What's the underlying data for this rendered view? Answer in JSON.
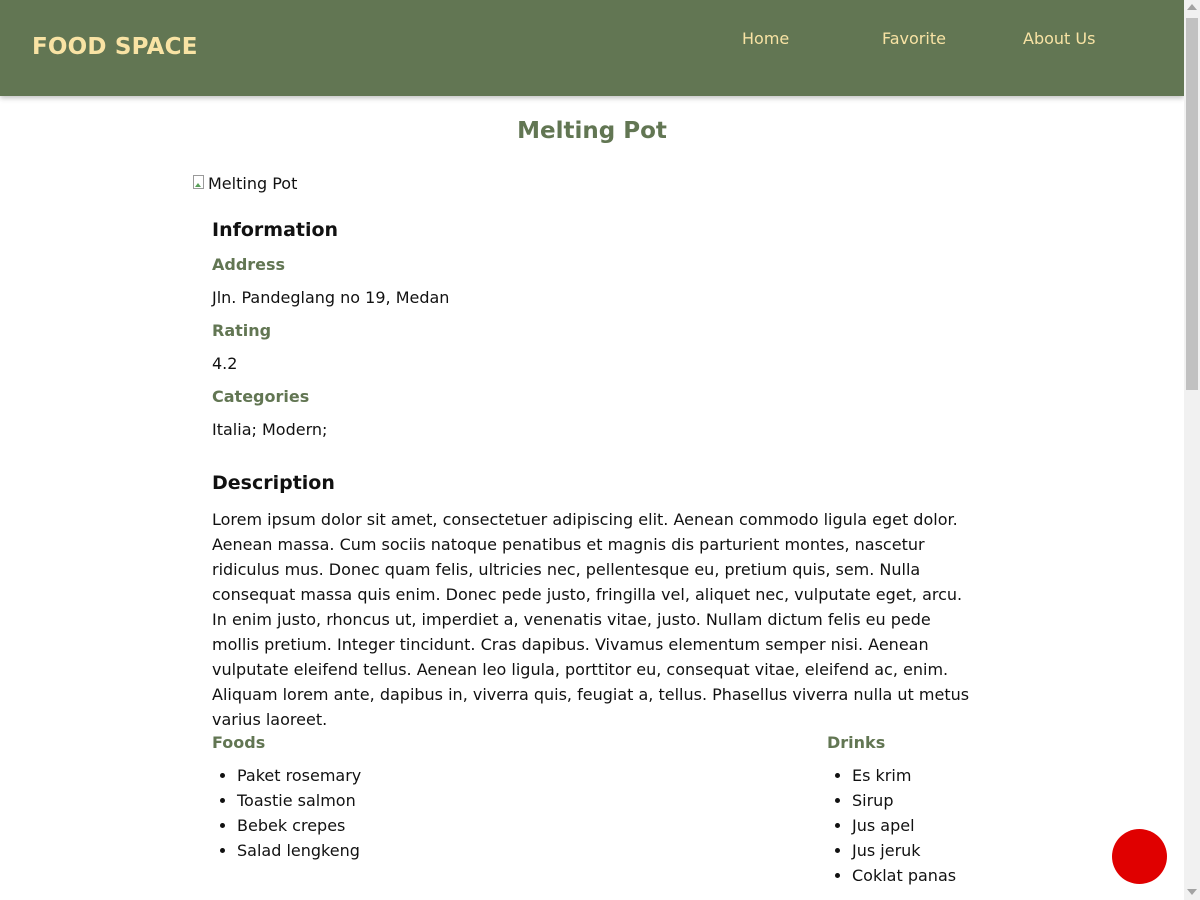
{
  "header": {
    "brand": "FOOD SPACE",
    "nav": {
      "home": "Home",
      "favorite": "Favorite",
      "about": "About Us"
    }
  },
  "restaurant": {
    "name": "Melting Pot",
    "image_alt": "Melting Pot",
    "information_heading": "Information",
    "address_label": "Address",
    "address": "Jln. Pandeglang no 19, Medan",
    "rating_label": "Rating",
    "rating": "4.2",
    "categories_label": "Categories",
    "categories": "Italia; Modern;",
    "description_heading": "Description",
    "description": "Lorem ipsum dolor sit amet, consectetuer adipiscing elit. Aenean commodo ligula eget dolor. Aenean massa. Cum sociis natoque penatibus et magnis dis parturient montes, nascetur ridiculus mus. Donec quam felis, ultricies nec, pellentesque eu, pretium quis, sem. Nulla consequat massa quis enim. Donec pede justo, fringilla vel, aliquet nec, vulputate eget, arcu. In enim justo, rhoncus ut, imperdiet a, venenatis vitae, justo. Nullam dictum felis eu pede mollis pretium. Integer tincidunt. Cras dapibus. Vivamus elementum semper nisi. Aenean vulputate eleifend tellus. Aenean leo ligula, porttitor eu, consequat vitae, eleifend ac, enim. Aliquam lorem ante, dapibus in, viverra quis, feugiat a, tellus. Phasellus viverra nulla ut metus varius laoreet.",
    "foods_label": "Foods",
    "foods": [
      "Paket rosemary",
      "Toastie salmon",
      "Bebek crepes",
      "Salad lengkeng"
    ],
    "drinks_label": "Drinks",
    "drinks": [
      "Es krim",
      "Sirup",
      "Jus apel",
      "Jus jeruk",
      "Coklat panas"
    ]
  },
  "colors": {
    "header_bg": "#627653",
    "brand_text": "#f8e3a4",
    "accent": "#627653",
    "fab": "#e00000"
  },
  "icons": {
    "broken_image": "broken-image-icon",
    "favorite_button": "favorite-button"
  }
}
